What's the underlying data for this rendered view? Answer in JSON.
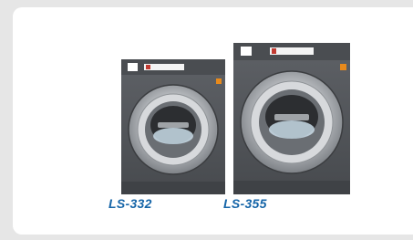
{
  "products": [
    {
      "label": "LS-332"
    },
    {
      "label": "LS-355"
    }
  ],
  "colors": {
    "label": "#1565a8",
    "background": "#e6e6e6",
    "card": "#ffffff",
    "machine_body": "#55595e",
    "indicator": "#e88a1c"
  }
}
